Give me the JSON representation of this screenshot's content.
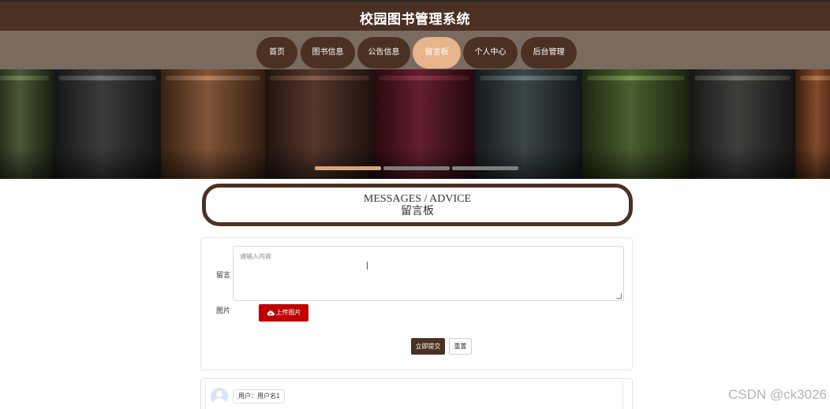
{
  "header": {
    "title": "校园图书管理系统"
  },
  "nav": {
    "items": [
      {
        "label": "首页",
        "active": false
      },
      {
        "label": "图书信息",
        "active": false
      },
      {
        "label": "公告信息",
        "active": false
      },
      {
        "label": "留言板",
        "active": true
      },
      {
        "label": "个人中心",
        "active": false
      },
      {
        "label": "后台管理",
        "active": false
      }
    ]
  },
  "banner": {
    "image": "bookshelf-leather-spines",
    "slides_total": 3,
    "slide_active_index": 0
  },
  "section": {
    "title_en": "MESSAGES / ADVICE",
    "title_cn": "留言板"
  },
  "form": {
    "message_label": "留言",
    "message_placeholder": "请输入内容",
    "image_label": "图片",
    "upload_label": "上传图片",
    "upload_icon": "cloud-upload-icon",
    "submit_label": "立即提交",
    "reset_label": "重置"
  },
  "comments": [
    {
      "user_label": "用户：用户名1",
      "avatar_icon": "user-avatar-icon"
    }
  ],
  "watermark": "CSDN @ck3026",
  "colors": {
    "brand_dark": "#4b3123",
    "nav_bar": "#7a6b60",
    "nav_active": "#e8b48c",
    "upload_red": "#c00000"
  }
}
